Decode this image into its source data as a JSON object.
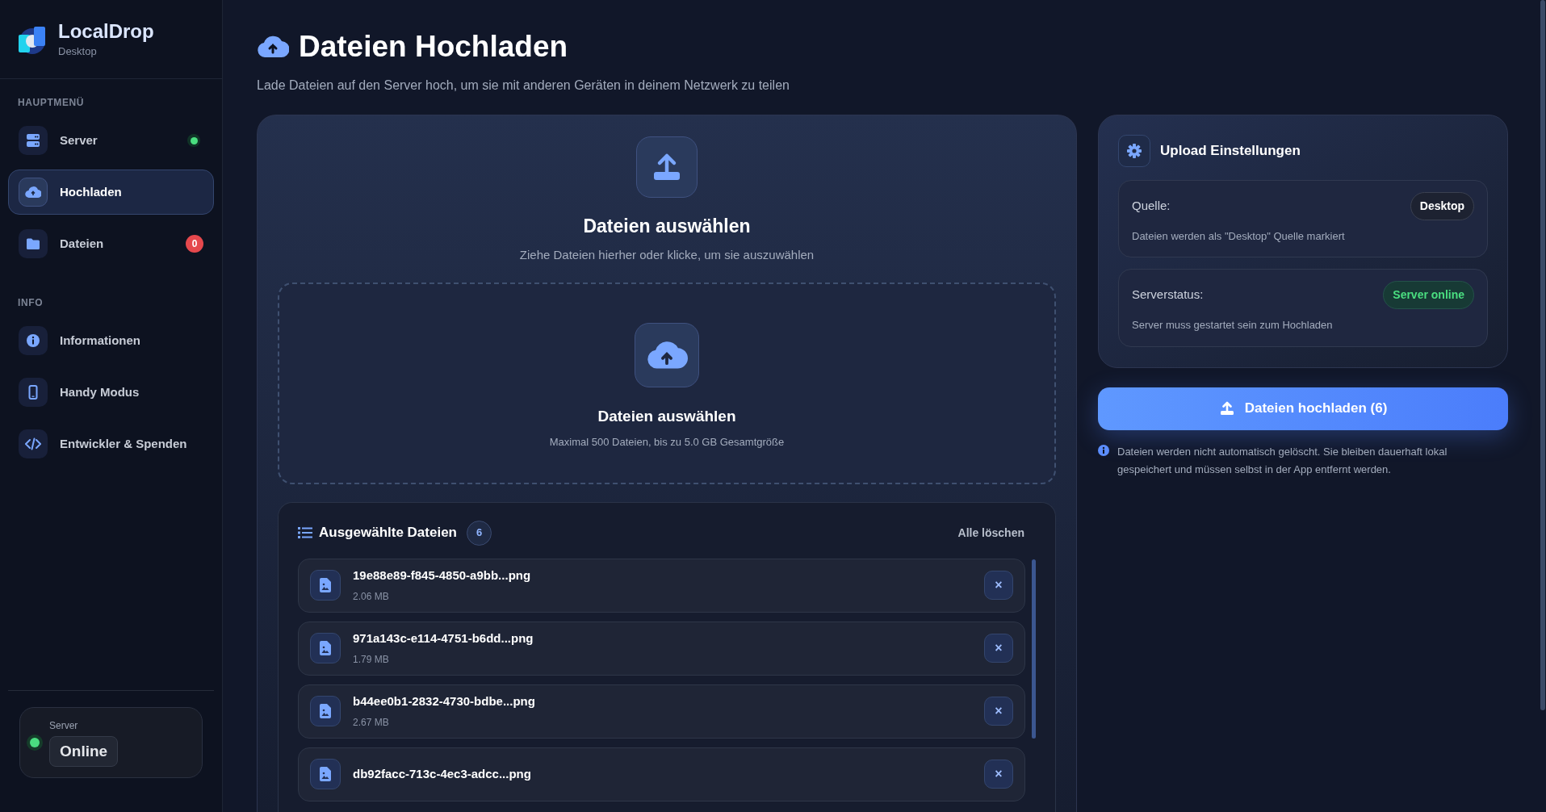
{
  "app": {
    "name": "LocalDrop",
    "subtitle": "Desktop"
  },
  "sidebar": {
    "sections": [
      {
        "title": "HAUPTMENÜ",
        "items": [
          {
            "label": "Server",
            "selected": false,
            "online": true
          },
          {
            "label": "Hochladen",
            "selected": true
          },
          {
            "label": "Dateien",
            "selected": false,
            "badge": "0"
          }
        ]
      },
      {
        "title": "INFO",
        "items": [
          {
            "label": "Informationen",
            "selected": false
          },
          {
            "label": "Handy Modus",
            "selected": false
          },
          {
            "label": "Entwickler & Spenden",
            "selected": false
          }
        ]
      }
    ],
    "server_status": {
      "label": "Server",
      "value": "Online",
      "color": "#4ade80"
    }
  },
  "page": {
    "title": "Dateien Hochladen",
    "subtitle": "Lade Dateien auf den Server hoch, um sie mit anderen Geräten in deinem Netzwerk zu teilen"
  },
  "upload_card": {
    "title": "Dateien auswählen",
    "hint": "Ziehe Dateien hierher oder klicke, um sie auszuwählen",
    "dropzone": {
      "title": "Dateien auswählen",
      "hint": "Maximal 500 Dateien, bis zu 5.0 GB Gesamtgröße"
    }
  },
  "selected_files": {
    "title": "Ausgewählte Dateien",
    "count": "6",
    "clear_label": "Alle löschen",
    "remove_label": "×",
    "files": [
      {
        "name": "19e88e89-f845-4850-a9bb...png",
        "size": "2.06 MB"
      },
      {
        "name": "971a143c-e114-4751-b6dd...png",
        "size": "1.79 MB"
      },
      {
        "name": "b44ee0b1-2832-4730-bdbe...png",
        "size": "2.67 MB"
      },
      {
        "name": "db92facc-713c-4ec3-adcc...png"
      }
    ]
  },
  "settings": {
    "title": "Upload Einstellungen",
    "cards": [
      {
        "label": "Quelle:",
        "pill": "Desktop",
        "kind": "neutral",
        "note": "Dateien werden als \"Desktop\" Quelle markiert"
      },
      {
        "label": "Serverstatus:",
        "pill": "Server online",
        "kind": "success",
        "note": "Server muss gestartet sein zum Hochladen"
      }
    ]
  },
  "upload_button": "Dateien hochladen (6)",
  "info_note": "Dateien werden nicht automatisch gelöscht. Sie bleiben dauerhaft lokal gespeichert und müssen selbst in der App entfernt werden."
}
